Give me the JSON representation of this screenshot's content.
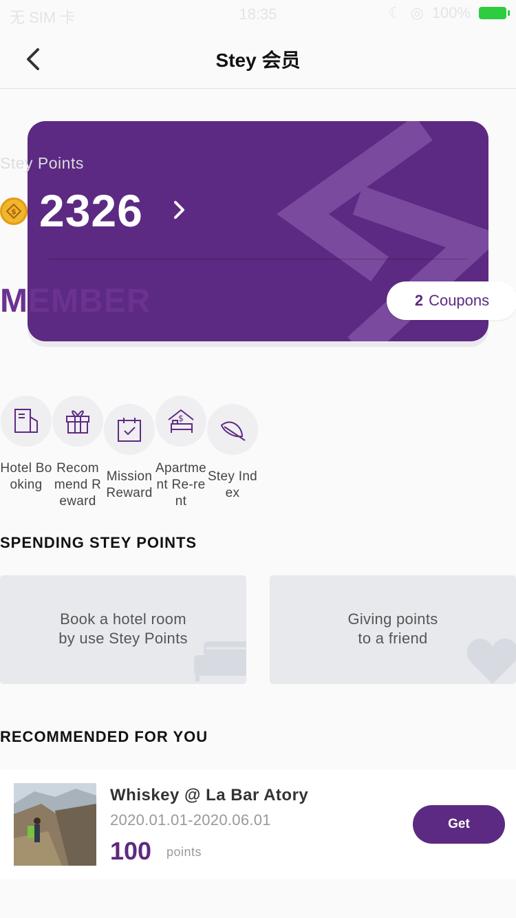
{
  "status_bar": {
    "carrier": "无 SIM 卡",
    "time": "18:35",
    "battery": "100%"
  },
  "nav": {
    "title": "Stey 会员"
  },
  "member_card": {
    "points_label": "Stey Points",
    "points_value": "2326",
    "member_level": "MEMBER",
    "coupons_count": "2",
    "coupons_label": "Coupons"
  },
  "shortcuts": [
    {
      "label": "Hotel Booking",
      "icon": "document-icon"
    },
    {
      "label": "Recommend Reward",
      "icon": "gift-icon"
    },
    {
      "label": "Mission Reward",
      "icon": "calendar-check-icon"
    },
    {
      "label": "Apartment Re-rent",
      "icon": "bed-dollar-icon"
    },
    {
      "label": "Stey Index",
      "icon": "leaf-icon"
    }
  ],
  "spending": {
    "title": "SPENDING STEY POINTS",
    "cards": [
      {
        "line1": "Book a hotel room",
        "line2": "by use Stey Points",
        "icon": "bed-icon"
      },
      {
        "line1": "Giving points",
        "line2": "to a friend",
        "icon": "heart-icon"
      }
    ]
  },
  "recommended": {
    "title": "RECOMMENDED FOR YOU",
    "items": [
      {
        "title": "Whiskey @ La Bar Atory",
        "dates": "2020.01.01-2020.06.01",
        "points": "100",
        "points_unit": "points",
        "button": "Get"
      }
    ]
  },
  "colors": {
    "brand_purple": "#5c2a82",
    "card_background": "#5c2a82",
    "tile_background": "#e7e9ed",
    "page_background": "#fafafa"
  }
}
